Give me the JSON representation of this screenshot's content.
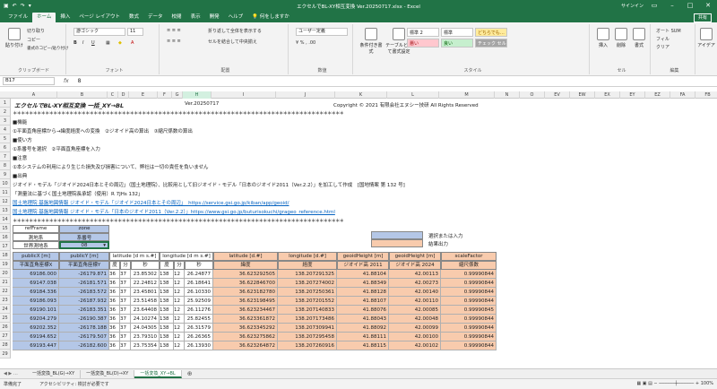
{
  "window": {
    "title": "エクセルでBL-XY相互変換 Ver.20250717.xlsx  -  Excel",
    "signin": "サインイン",
    "share": "共有",
    "search": "何をしますか"
  },
  "tabs": [
    "ファイル",
    "ホーム",
    "挿入",
    "ページ レイアウト",
    "数式",
    "データ",
    "校閲",
    "表示",
    "開発",
    "ヘルプ"
  ],
  "ribbon": {
    "clipboard": {
      "paste": "貼り付け",
      "cut": "切り取り",
      "copy": "コピー",
      "format": "書式のコピー/貼り付け",
      "label": "クリップボード"
    },
    "font": {
      "name": "游ゴシック",
      "size": "11",
      "label": "フォント"
    },
    "align": {
      "wrap": "折り返して全体を表示する",
      "merge": "セルを結合して中央揃え",
      "label": "配置"
    },
    "number": {
      "format": "ユーザー定義",
      "label": "数値"
    },
    "styles": {
      "cond": "条件付き書式",
      "table": "テーブルとして書式設定",
      "s1": "標準 2",
      "s2": "標準",
      "s3": "どちらでも…",
      "s4": "悪い",
      "s5": "良い",
      "s6": "チェック セル",
      "label": "スタイル"
    },
    "cells": {
      "insert": "挿入",
      "delete": "削除",
      "format": "書式",
      "label": "セル"
    },
    "edit": {
      "autosum": "オート SUM",
      "fill": "フィル",
      "clear": "クリア",
      "sort": "並べ替えとフィルター",
      "find": "検索と選択",
      "label": "編集"
    },
    "ideas": "アイデア"
  },
  "formula_bar": {
    "cell": "B17",
    "value": "8"
  },
  "columns": [
    "A",
    "B",
    "C",
    "D",
    "E",
    "F",
    "G",
    "H",
    "I",
    "J",
    "K",
    "L",
    "M",
    "N",
    "O",
    "EV",
    "EW",
    "EX",
    "EY",
    "EZ",
    "FA",
    "FB",
    "FC",
    "FD"
  ],
  "rows": [
    "1",
    "2",
    "3",
    "4",
    "5",
    "6",
    "7",
    "8",
    "9",
    "10",
    "11",
    "12",
    "13",
    "14",
    "15",
    "16",
    "17",
    "18",
    "19",
    "20",
    "21",
    "22",
    "23",
    "24",
    "25",
    "26",
    "27",
    "28",
    "29"
  ],
  "sheet": {
    "title": "エクセルでBL-XY相互変換 一括_XY→BL",
    "version": "Ver.20250717",
    "copyright": "Copyright © 2021 有限会社エヌシー技研 All Rights Reserved",
    "stars": "＊＊＊＊＊＊＊＊＊＊＊＊＊＊＊＊＊＊＊＊＊＊＊＊＊＊＊＊＊＊＊＊＊＊＊＊＊＊＊＊＊＊＊＊＊＊＊＊＊＊＊＊＊＊＊＊＊＊＊＊＊＊＊＊＊＊＊＊＊＊＊＊＊＊＊＊＊＊＊＊＊＊",
    "r3": "■機能",
    "r4": "①平面直角座標から→緯度経度への変換　②ジオイド高の算出　③縮尺係数の算出",
    "r5": "■使い方",
    "r6": "①系番号を選択　②平面直角座標を入力",
    "r7": "■注意",
    "r8": "①本システムの利用により生じた損失及び損害について、弊社は一切の責任を負いません",
    "r9": "■出典",
    "r10": "ジオイド・モデル「ジオイド2024日本とその周辺」（国土地理院）、比較用として旧ジオイド・モデル「日本のジオイド2011（Ver.2.2）」を加工して作成　[国地情案 第 132 号]",
    "r11": "「測量法に基づく国土地理院長承認（使用）R 7JHs 132」",
    "r12": "国土地理院 基盤地図情報 ジオイド・モデル「ジオイド2024日本とその周辺」　https://service.gsi.go.jp/kiban/app/geoid/",
    "r13": "国土地理院 基盤地図情報 ジオイド・モデル「日本のジオイド2011（Ver.2.2）」https://www.gsi.go.jp/buturisokuchi/grageo_reference.html",
    "refframe_h": "refFrame",
    "refframe_s": "測地系",
    "zone_h": "zone",
    "zone_s": "系番号",
    "refframe_v": "世界測地系",
    "zone_v": "08",
    "legend_in": "選択または入力",
    "legend_out": "結果出力"
  },
  "table": {
    "h1": [
      "publicX [m]",
      "publicY [m]",
      "latitude [d m s.#]",
      "",
      "",
      "longitude [d m s.#]",
      "",
      "",
      "latitude [d.#]",
      "longitude [d.#]",
      "geoidHeight [m]",
      "geoidHeight [m]",
      "scaleFactor"
    ],
    "h2": [
      "平面直角座標X",
      "平面直角座標Y",
      "度",
      "分",
      "秒",
      "度",
      "分",
      "秒",
      "緯度",
      "経度",
      "ジオイド高 2011",
      "ジオイド高 2024",
      "縮尺係数"
    ],
    "rows": [
      [
        "69186.000",
        "-26179.871",
        "36",
        "37",
        "23.85302",
        "138",
        "12",
        "26.24877",
        "36.623292505",
        "138.207291325",
        "41.88104",
        "42.00113",
        "0.99990844"
      ],
      [
        "69147.038",
        "-26181.571",
        "36",
        "37",
        "22.24812",
        "138",
        "12",
        "26.18641",
        "36.622846700",
        "138.207274002",
        "41.88349",
        "42.00273",
        "0.99990844"
      ],
      [
        "69184.336",
        "-26183.572",
        "36",
        "37",
        "23.45801",
        "138",
        "12",
        "26.10330",
        "36.623182780",
        "138.207250361",
        "41.88128",
        "42.00140",
        "0.99990844"
      ],
      [
        "69186.093",
        "-26187.932",
        "36",
        "37",
        "23.51458",
        "138",
        "12",
        "25.92509",
        "36.623198495",
        "138.207201552",
        "41.88107",
        "42.00110",
        "0.99990844"
      ],
      [
        "69190.101",
        "-26183.351",
        "36",
        "37",
        "23.64408",
        "138",
        "12",
        "26.11276",
        "36.623234467",
        "138.207140833",
        "41.88076",
        "42.00085",
        "0.99990845"
      ],
      [
        "69204.279",
        "-26190.387",
        "36",
        "37",
        "24.10274",
        "138",
        "12",
        "25.82455",
        "36.623361872",
        "138.207173486",
        "41.88043",
        "42.00048",
        "0.99990844"
      ],
      [
        "69202.352",
        "-26178.188",
        "36",
        "37",
        "24.04305",
        "138",
        "12",
        "26.31579",
        "36.623345292",
        "138.207309941",
        "41.88092",
        "42.00099",
        "0.99990844"
      ],
      [
        "69194.652",
        "-26179.507",
        "36",
        "37",
        "23.79310",
        "138",
        "12",
        "26.26365",
        "36.623275862",
        "138.207295458",
        "41.88111",
        "42.00100",
        "0.99990844"
      ],
      [
        "69193.447",
        "-26182.600",
        "36",
        "37",
        "23.75354",
        "138",
        "12",
        "26.13930",
        "36.623264872",
        "138.207260916",
        "41.88115",
        "42.00102",
        "0.99990844"
      ]
    ]
  },
  "sheet_tabs": [
    "一括変換_BL(G)→XY",
    "一括変換_BL(D)→XY",
    "一括変換_XY→BL"
  ],
  "status": {
    "ready": "準備完了",
    "access": "アクセシビリティ: 検討が必要です",
    "zoom": "100%"
  }
}
